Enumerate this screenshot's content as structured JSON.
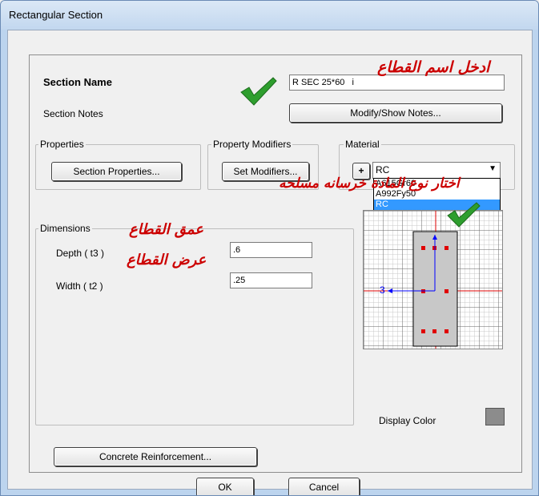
{
  "window": {
    "title": "Rectangular Section"
  },
  "section": {
    "name_label": "Section Name",
    "name_value": "R SEC 25*60",
    "name_cursor": "i",
    "notes_label": "Section Notes",
    "notes_button": "Modify/Show Notes..."
  },
  "properties": {
    "group_label": "Properties",
    "button": "Section Properties..."
  },
  "modifiers": {
    "group_label": "Property Modifiers",
    "button": "Set Modifiers..."
  },
  "material": {
    "group_label": "Material",
    "add_button": "+",
    "selected": "RC",
    "options": [
      "A615Gr60",
      "A992Fy50",
      "RC"
    ],
    "dropdown_arrow": "▼"
  },
  "dimensions": {
    "group_label": "Dimensions",
    "depth_label": "Depth  ( t3 )",
    "depth_value": ".6",
    "width_label": "Width  ( t2 )",
    "width_value": ".25"
  },
  "preview": {
    "axis_label": "3",
    "display_color_label": "Display Color",
    "display_color": "#8c8c8c"
  },
  "buttons": {
    "concrete": "Concrete Reinforcement...",
    "ok": "OK",
    "cancel": "Cancel"
  },
  "annotations": {
    "name_hint": "ادخل اسم القطاع",
    "material_hint": "اختار نوع المادة خرسانه مسلحه",
    "depth_hint": "عمق القطاع",
    "width_hint": "عرض القطاع"
  },
  "colors": {
    "annotation": "#cc0000",
    "check": "#2e9e2e",
    "selection": "#3399ff",
    "axis": "#0000ff"
  }
}
